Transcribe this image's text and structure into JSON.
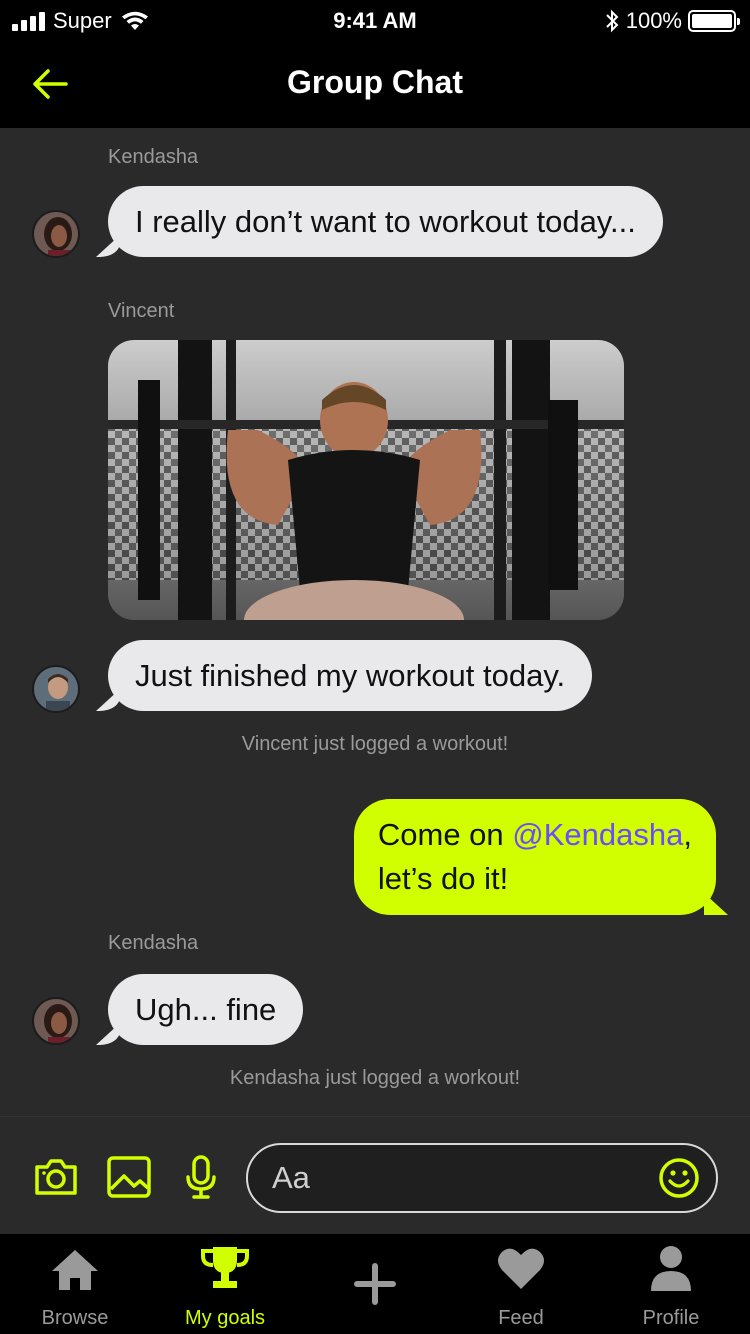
{
  "status_bar": {
    "carrier": "Super",
    "time": "9:41 AM",
    "battery": "100%"
  },
  "header": {
    "title": "Group Chat"
  },
  "messages": [
    {
      "sender": "Kendasha",
      "text": "I really don’t want to workout today..."
    },
    {
      "sender": "Vincent",
      "text": "Just finished my workout today."
    },
    {
      "system": "Vincent just logged a workout!"
    },
    {
      "text_before": "Come on ",
      "mention": "@Kendasha",
      "text_after": ",",
      "line2": "let’s do it!"
    },
    {
      "sender": "Kendasha",
      "text": "Ugh... fine"
    },
    {
      "system": "Kendasha just logged a workout!"
    }
  ],
  "composer": {
    "placeholder": "Aa",
    "tools": [
      "camera-icon",
      "image-icon",
      "microphone-icon"
    ]
  },
  "tabs": [
    {
      "label": "Browse",
      "icon": "home-icon",
      "active": false
    },
    {
      "label": "My goals",
      "icon": "trophy-icon",
      "active": true
    },
    {
      "label": "",
      "icon": "plus-icon",
      "active": false
    },
    {
      "label": "Feed",
      "icon": "heart-icon",
      "active": false
    },
    {
      "label": "Profile",
      "icon": "person-icon",
      "active": false
    }
  ],
  "colors": {
    "accent": "#d1ff00",
    "mention": "#6c4bff",
    "background": "#2a2a2a",
    "incoming_bubble": "#e9e9eb"
  }
}
